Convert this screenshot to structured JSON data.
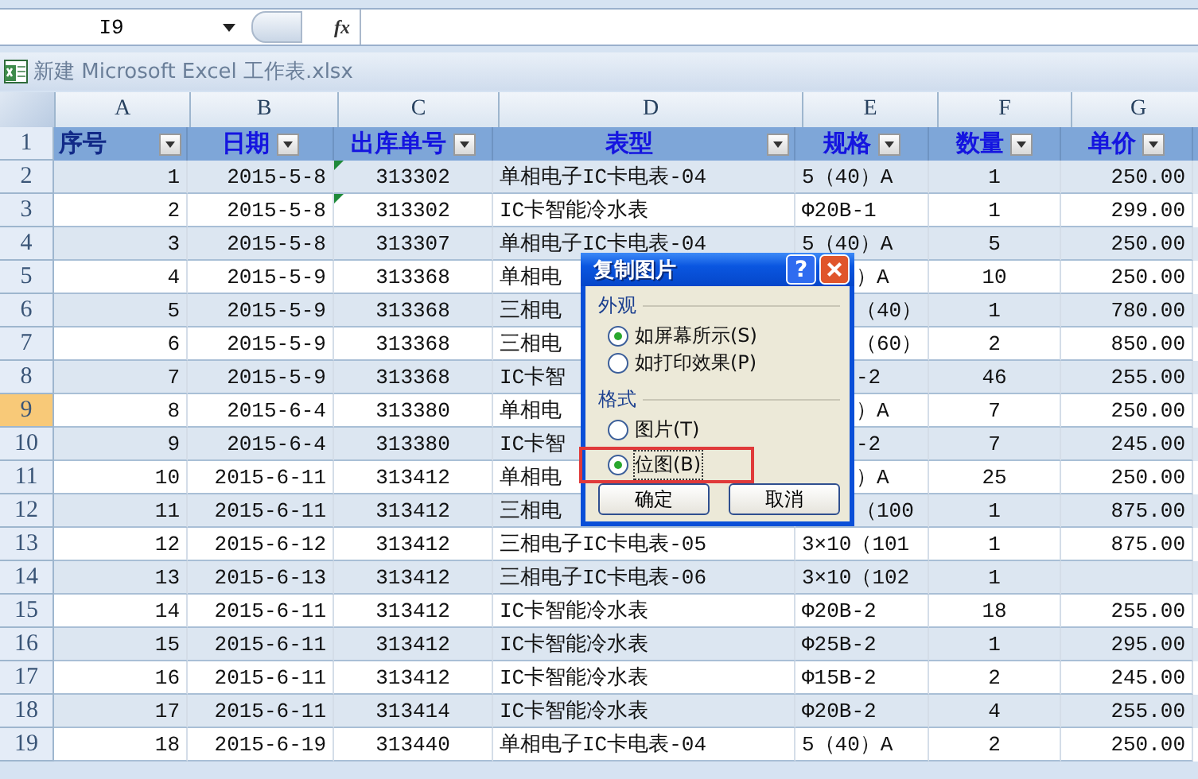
{
  "formula_bar": {
    "name_box": "I9",
    "fx": "fx"
  },
  "workbook": {
    "title": "新建 Microsoft Excel 工作表.xlsx"
  },
  "columns": [
    "A",
    "B",
    "C",
    "D",
    "E",
    "F",
    "G"
  ],
  "header_row": {
    "number": "1",
    "cells": [
      "序号",
      "日期",
      "出库单号",
      "表型",
      "规格",
      "数量",
      "单价"
    ]
  },
  "rows": [
    {
      "number": "2",
      "selected": false,
      "error_mark": true,
      "cells": [
        "1",
        "2015-5-8",
        "313302",
        "单相电子IC卡电表-04",
        "5（40）A",
        "1",
        "250.00"
      ]
    },
    {
      "number": "3",
      "selected": false,
      "error_mark": true,
      "cells": [
        "2",
        "2015-5-8",
        "313302",
        "IC卡智能冷水表",
        "Φ20B-1",
        "1",
        "299.00"
      ]
    },
    {
      "number": "4",
      "selected": false,
      "error_mark": false,
      "cells": [
        "3",
        "2015-5-8",
        "313307",
        "单相电子IC卡电表-04",
        "5（40）A",
        "5",
        "250.00"
      ]
    },
    {
      "number": "5",
      "selected": false,
      "error_mark": false,
      "cells": [
        "4",
        "2015-5-9",
        "313368",
        "单相电",
        "）A",
        "10",
        "250.00"
      ]
    },
    {
      "number": "6",
      "selected": false,
      "error_mark": false,
      "cells": [
        "5",
        "2015-5-9",
        "313368",
        "三相电",
        "（40）",
        "1",
        "780.00"
      ]
    },
    {
      "number": "7",
      "selected": false,
      "error_mark": false,
      "cells": [
        "6",
        "2015-5-9",
        "313368",
        "三相电",
        "（60）",
        "2",
        "850.00"
      ]
    },
    {
      "number": "8",
      "selected": false,
      "error_mark": false,
      "cells": [
        "7",
        "2015-5-9",
        "313368",
        "IC卡智",
        "-2",
        "46",
        "255.00"
      ]
    },
    {
      "number": "9",
      "selected": true,
      "error_mark": false,
      "cells": [
        "8",
        "2015-6-4",
        "313380",
        "单相电",
        "）A",
        "7",
        "250.00"
      ]
    },
    {
      "number": "10",
      "selected": false,
      "error_mark": false,
      "cells": [
        "9",
        "2015-6-4",
        "313380",
        "IC卡智",
        "-2",
        "7",
        "245.00"
      ]
    },
    {
      "number": "11",
      "selected": false,
      "error_mark": false,
      "cells": [
        "10",
        "2015-6-11",
        "313412",
        "单相电",
        "）A",
        "25",
        "250.00"
      ]
    },
    {
      "number": "12",
      "selected": false,
      "error_mark": false,
      "cells": [
        "11",
        "2015-6-11",
        "313412",
        "三相电",
        "（100",
        "1",
        "875.00"
      ]
    },
    {
      "number": "13",
      "selected": false,
      "error_mark": false,
      "cells": [
        "12",
        "2015-6-12",
        "313412",
        "三相电子IC卡电表-05",
        "3×10（101",
        "1",
        "875.00"
      ]
    },
    {
      "number": "14",
      "selected": false,
      "error_mark": false,
      "cells": [
        "13",
        "2015-6-13",
        "313412",
        "三相电子IC卡电表-06",
        "3×10（102",
        "1"
      ]
    },
    {
      "number": "15",
      "selected": false,
      "error_mark": false,
      "cells": [
        "14",
        "2015-6-11",
        "313412",
        "IC卡智能冷水表",
        "Φ20B-2",
        "18",
        "255.00"
      ]
    },
    {
      "number": "16",
      "selected": false,
      "error_mark": false,
      "cells": [
        "15",
        "2015-6-11",
        "313412",
        "IC卡智能冷水表",
        "Φ25B-2",
        "1",
        "295.00"
      ]
    },
    {
      "number": "17",
      "selected": false,
      "error_mark": false,
      "cells": [
        "16",
        "2015-6-11",
        "313412",
        "IC卡智能冷水表",
        "Φ15B-2",
        "2",
        "245.00"
      ]
    },
    {
      "number": "18",
      "selected": false,
      "error_mark": false,
      "cells": [
        "17",
        "2015-6-11",
        "313414",
        "IC卡智能冷水表",
        "Φ20B-2",
        "4",
        "255.00"
      ]
    },
    {
      "number": "19",
      "selected": false,
      "error_mark": false,
      "cells": [
        "18",
        "2015-6-19",
        "313440",
        "单相电子IC卡电表-04",
        "5（40）A",
        "2",
        "250.00"
      ]
    }
  ],
  "dialog": {
    "title": "复制图片",
    "help": "?",
    "groups": [
      {
        "label": "外观",
        "options": [
          {
            "label": "如屏幕所示(S)",
            "selected": true,
            "highlighted": false
          },
          {
            "label": "如打印效果(P)",
            "selected": false,
            "highlighted": false
          }
        ]
      },
      {
        "label": "格式",
        "options": [
          {
            "label": "图片(T)",
            "selected": false,
            "highlighted": false
          },
          {
            "label": "位图(B)",
            "selected": true,
            "highlighted": true
          }
        ]
      }
    ],
    "buttons": [
      "确定",
      "取消"
    ]
  }
}
